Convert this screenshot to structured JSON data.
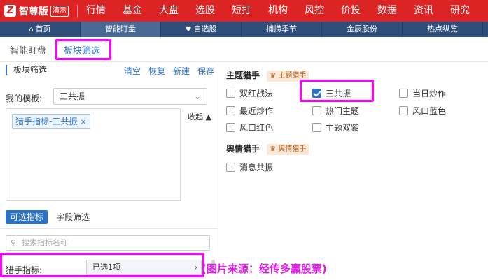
{
  "topbar": {
    "logo_text": "智尊版",
    "logo_badge": "演示",
    "menu": [
      "行情",
      "基金",
      "大盘",
      "选股",
      "短打",
      "机构",
      "风控",
      "价投",
      "数据",
      "资讯",
      "研究"
    ]
  },
  "tabbar": {
    "tabs": [
      {
        "label": "首页",
        "icon": "home-icon"
      },
      {
        "label": "智能盯盘"
      },
      {
        "label": "自选股",
        "icon": "heart-icon"
      },
      {
        "label": "捕捞季节"
      },
      {
        "label": "金辰股份"
      },
      {
        "label": "热点纵览"
      }
    ],
    "active_index": 1
  },
  "subtabs": [
    "智能盯盘",
    "板块筛选"
  ],
  "left": {
    "title": "板块筛选",
    "actions": [
      "清空",
      "恢复",
      "新建",
      "保存"
    ],
    "template_label": "我的模板:",
    "template_value": "三共振",
    "tag": "猎手指标-三共振",
    "collapse_label": "收起",
    "indicator_tabs": [
      "可选指标",
      "字段筛选"
    ],
    "search_placeholder": "搜索指标名称",
    "hunter_label": "猎手指标:",
    "hunter_value": "已选1项"
  },
  "source_note": "(图片来源：经传多赢股票)",
  "right": {
    "section1": {
      "title": "主题猎手",
      "badge": "主题猎手",
      "options": [
        {
          "label": "双红战法",
          "checked": false
        },
        {
          "label": "三共振",
          "checked": true
        },
        {
          "label": "当日炒作",
          "checked": false
        },
        {
          "label": "最近炒作",
          "checked": false
        },
        {
          "label": "热门主题",
          "checked": false
        },
        {
          "label": "风口蓝色",
          "checked": false
        },
        {
          "label": "风口红色",
          "checked": false
        },
        {
          "label": "主题双紫",
          "checked": false
        }
      ]
    },
    "section2": {
      "title": "舆情猎手",
      "badge": "舆情猎手",
      "options": [
        {
          "label": "消息共振",
          "checked": false
        }
      ]
    }
  },
  "colors": {
    "brand_red": "#dc2424",
    "nav_blue": "#2f4f7a",
    "accent_blue": "#2a73c9",
    "highlight_magenta": "#ff00ff"
  }
}
